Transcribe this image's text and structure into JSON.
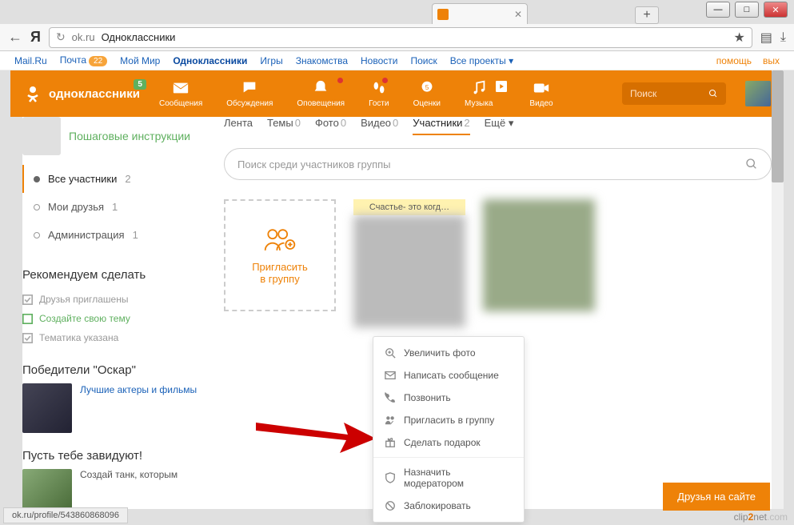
{
  "browser": {
    "back": "←",
    "brand": "Я",
    "host": "ok.ru",
    "title": "Одноклассники",
    "new_tab": "+",
    "star": "★",
    "reload": "↻"
  },
  "mailru": {
    "items": [
      "Mail.Ru",
      "Почта",
      "Мой Мир",
      "Одноклассники",
      "Игры",
      "Знакомства",
      "Новости",
      "Поиск",
      "Все проекты"
    ],
    "mail_badge": "22",
    "right": [
      "помощь",
      "вых"
    ]
  },
  "ok_header": {
    "logo_text": "одноклассники",
    "badge": "5",
    "nav": [
      {
        "label": "Сообщения"
      },
      {
        "label": "Обсуждения"
      },
      {
        "label": "Оповещения",
        "dot": true
      },
      {
        "label": "Гости",
        "dot": true
      },
      {
        "label": "Оценки"
      },
      {
        "label": "Музыка"
      },
      {
        "label": "Видео"
      }
    ],
    "search_placeholder": "Поиск"
  },
  "sidebar": {
    "group_title": "Пошаговые инструкции",
    "filters": [
      {
        "label": "Все участники",
        "count": "2",
        "active": true
      },
      {
        "label": "Мои друзья",
        "count": "1"
      },
      {
        "label": "Администрация",
        "count": "1"
      }
    ],
    "rec_title": "Рекомендуем сделать",
    "rec": [
      {
        "label": "Друзья приглашены",
        "done": true
      },
      {
        "label": "Создайте свою тему",
        "done": false
      },
      {
        "label": "Тематика указана",
        "done": true
      }
    ],
    "promo1_title": "Победители \"Оскар\"",
    "promo1_text": "Лучшие актеры и фильмы",
    "promo2_title": "Пусть тебе завидуют!",
    "promo2_text": "Создай танк, которым"
  },
  "main": {
    "tabs": [
      {
        "label": "Лента"
      },
      {
        "label": "Темы",
        "count": "0"
      },
      {
        "label": "Фото",
        "count": "0"
      },
      {
        "label": "Видео",
        "count": "0"
      },
      {
        "label": "Участники",
        "count": "2",
        "active": true
      },
      {
        "label": "Ещё ▾"
      }
    ],
    "search_placeholder": "Поиск среди участников группы",
    "invite_line1": "Пригласить",
    "invite_line2": "в группу",
    "member_label": "Счастье- это когд…"
  },
  "ctx": {
    "items": [
      "Увеличить фото",
      "Написать сообщение",
      "Позвонить",
      "Пригласить в группу",
      "Сделать подарок"
    ],
    "sep_items": [
      "Назначить модератором",
      "Заблокировать"
    ]
  },
  "footer": {
    "friends_btn": "Друзья на сайте",
    "status": "ok.ru/profile/543860868096",
    "watermark_a": "clip",
    "watermark_b": "2",
    "watermark_c": "net",
    "watermark_d": ".com"
  }
}
